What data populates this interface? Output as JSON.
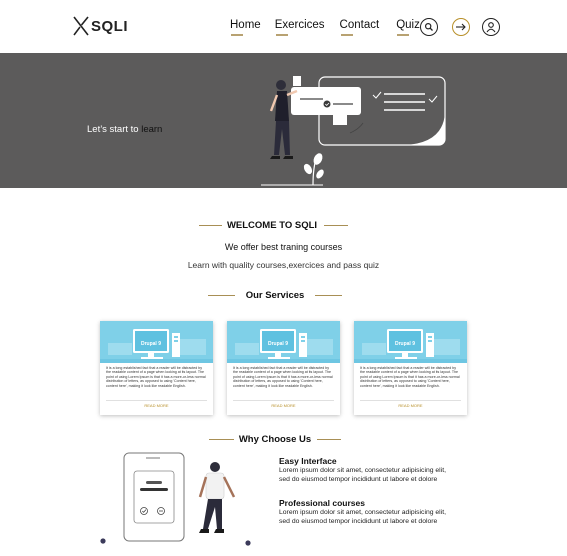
{
  "header": {
    "logo_text": "SQLI",
    "nav": [
      {
        "label": "Home"
      },
      {
        "label": "Exercices"
      },
      {
        "label": "Contact"
      },
      {
        "label": "Quiz"
      }
    ],
    "icons": [
      "search-icon",
      "logout-icon",
      "user-icon"
    ]
  },
  "hero": {
    "text_prefix": "Let’s start to ",
    "text_highlight": "learn"
  },
  "welcome": {
    "title": "WELCOME TO SQLI",
    "subtitle": "We offer best traning courses",
    "tagline": "Learn with quality courses,exercices and pass quiz"
  },
  "services": {
    "title": "Our Services",
    "cards": [
      {
        "image_label": "Drupal 9",
        "text": "It is a long established fact that a reader will be distracted by the readable content of a page when looking at its layout. The point of using Lorem Ipsum is that it has a more-or-less normal distribution of letters, as opposed to using 'Content here, content here', making it look like readable English.",
        "link": "READ MORE"
      },
      {
        "image_label": "Drupal 9",
        "text": "It is a long established fact that a reader will be distracted by the readable content of a page when looking at its layout. The point of using Lorem Ipsum is that it has a more-or-less normal distribution of letters, as opposed to using 'Content here, content here', making it look like readable English.",
        "link": "READ MORE"
      },
      {
        "image_label": "Drupal 9",
        "text": "It is a long established fact that a reader will be distracted by the readable content of a page when looking at its layout. The point of using Lorem Ipsum is that it has a more-or-less normal distribution of letters, as opposed to using 'Content here, content here', making it look like readable English.",
        "link": "READ MORE"
      }
    ]
  },
  "why": {
    "title": "Why Choose Us",
    "features": [
      {
        "title": "Easy Interface",
        "body": "Lorem ipsum dolor sit amet, consectetur adipisicing elit, sed do eiusmod tempor incididunt ut labore et dolore"
      },
      {
        "title": "Professional courses",
        "body": "Lorem ipsum dolor sit amet, consectetur adipisicing elit, sed do eiusmod tempor incididunt ut labore et dolore"
      }
    ]
  },
  "colors": {
    "accent": "#a88f55",
    "hero_bg": "#5c5b5b",
    "card_image_bg": "#7fd0e8"
  }
}
